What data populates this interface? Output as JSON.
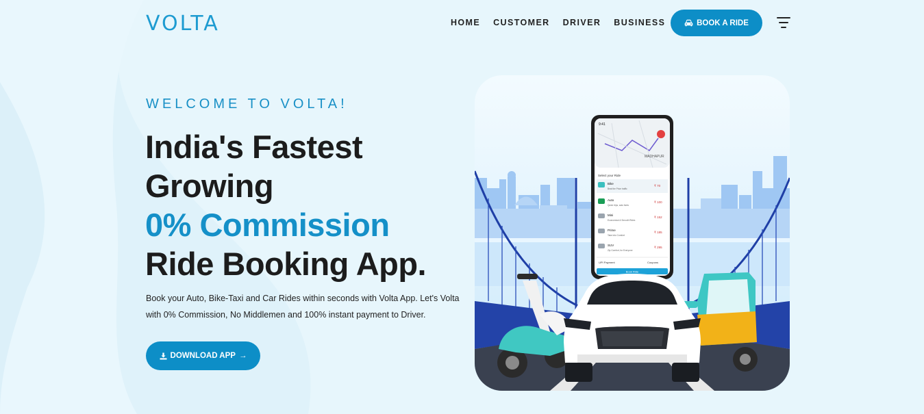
{
  "brand": {
    "name": "VOLTA"
  },
  "nav": {
    "items": [
      "HOME",
      "CUSTOMER",
      "DRIVER",
      "BUSINESS"
    ],
    "cta_label": "BOOK A RIDE"
  },
  "hero": {
    "kicker": "WELCOME TO VOLTA!",
    "headline_line1": "India's Fastest",
    "headline_line2": "Growing",
    "headline_accent": "0% Commission",
    "headline_line4": "Ride Booking App.",
    "description": "Book your Auto, Bike-Taxi and Car Rides within seconds with Volta App. Let's Volta with 0% Commission, No Middlemen and 100% instant payment to Driver.",
    "download_label": "DOWNLOAD APP"
  },
  "phone": {
    "status_time": "9:41",
    "map_label": "MADHAPUR",
    "select_title": "Select your Ride",
    "rides": [
      {
        "name": "Bike",
        "desc": "Beat the Price traffic",
        "price": "₹ 70"
      },
      {
        "name": "Auto",
        "desc": "Quick trips, auto fares",
        "price": "₹ 100"
      },
      {
        "name": "Mini",
        "desc": "Economical & Smooth Rides",
        "price": "₹ 152"
      },
      {
        "name": "Prime",
        "desc": "Take into Comfort",
        "price": "₹ 185"
      },
      {
        "name": "SUV",
        "desc": "Zip Comfort, for Everyone",
        "price": "₹ 295"
      }
    ],
    "payment_label": "UPI Payment",
    "coupons_label": "Coupons",
    "book_label": "Book Ride"
  },
  "colors": {
    "accent": "#0d8ec7",
    "headline": "#1c1c1c",
    "background": "#e6f5fb"
  }
}
